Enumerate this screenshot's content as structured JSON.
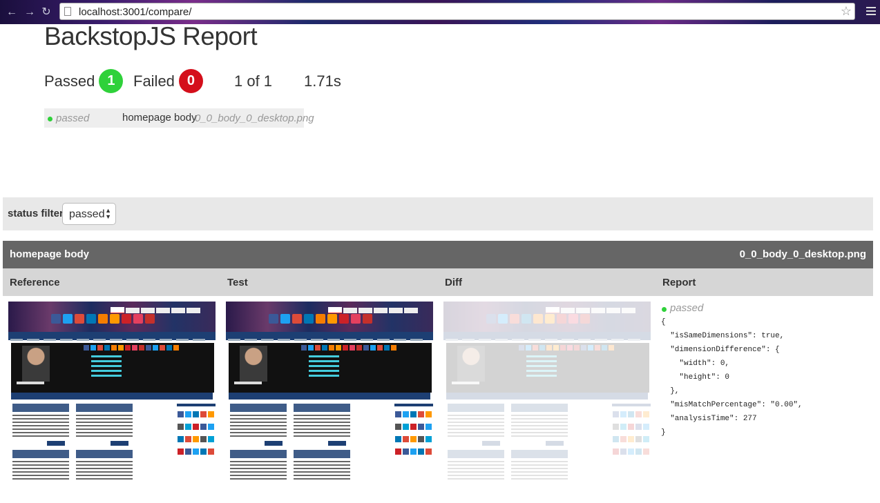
{
  "browser": {
    "url": "localhost:3001/compare/"
  },
  "header": {
    "title": "BackstopJS Report",
    "passed_label": "Passed",
    "passed_count": "1",
    "failed_label": "Failed",
    "failed_count": "0",
    "progress": "1 of 1",
    "duration": "1.71s"
  },
  "summary": {
    "status": "passed",
    "label": "homepage body",
    "file": "0_0_body_0_desktop.png"
  },
  "filter": {
    "label": "status filter",
    "selected": "passed"
  },
  "test": {
    "label": "homepage body",
    "file": "0_0_body_0_desktop.png",
    "columns": [
      "Reference",
      "Test",
      "Diff",
      "Report"
    ],
    "report_status": "passed",
    "report_json": "{\n  \"isSameDimensions\": true,\n  \"dimensionDifference\": {\n    \"width\": 0,\n    \"height\": 0\n  },\n  \"misMatchPercentage\": \"0.00\",\n  \"analysisTime\": 277\n}"
  },
  "colors": {
    "pass": "#2fd13a",
    "fail": "#d40f1b",
    "header_bg": "#666666",
    "column_bg": "#d6d6d6"
  }
}
